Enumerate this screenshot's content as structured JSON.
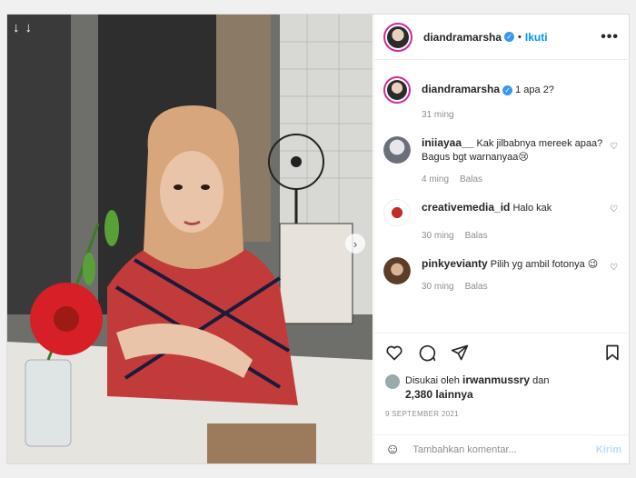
{
  "post": {
    "author": "diandramarsha",
    "follow_label": "Ikuti",
    "more_label": "•••",
    "separator": "•"
  },
  "comments": [
    {
      "user": "diandramarsha",
      "verified": true,
      "text": "1 apa 2?",
      "time": "31 ming",
      "reply": ""
    },
    {
      "user": "iniiayaa__",
      "verified": false,
      "text": "Kak jilbabnya mereek apaa? Bagus bgt warnanyaa😢",
      "time": "4 ming",
      "reply": "Balas"
    },
    {
      "user": "creativemedia_id",
      "verified": false,
      "text": "Halo kak",
      "time": "30 ming",
      "reply": "Balas"
    },
    {
      "user": "pinkyevianty",
      "verified": false,
      "text": "Pilih yg ambil fotonya 😉",
      "time": "30 ming",
      "reply": "Balas"
    }
  ],
  "likes": {
    "prefix": "Disukai oleh",
    "user": "irwanmussry",
    "joiner": "dan",
    "others": "2,380 lainnya"
  },
  "date": "9 SEPTEMBER 2021",
  "add_comment": {
    "placeholder": "Tambahkan komentar...",
    "post_label": "Kirim"
  },
  "icons": {
    "heart": "heart-icon",
    "comment": "comment-icon",
    "share": "share-icon",
    "save": "bookmark-icon",
    "emoji": "emoji-icon",
    "next": "chevron-right-icon"
  },
  "colors": {
    "accent": "#0095f6",
    "verified": "#3897f0",
    "muted": "#8e8e8e"
  }
}
